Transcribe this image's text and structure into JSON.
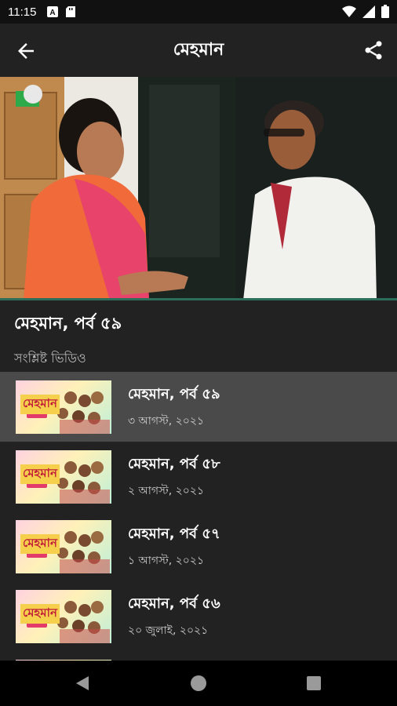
{
  "status_bar": {
    "time": "11:15",
    "icons_left": [
      "a-icon",
      "sd-card-icon"
    ],
    "icons_right": [
      "wifi-icon",
      "signal-icon",
      "battery-icon"
    ]
  },
  "app_bar": {
    "title": "মেহমান",
    "back_icon": "arrow-back-icon",
    "share_icon": "share-icon"
  },
  "video": {
    "title": "মেহমান, পর্ব ৫৯",
    "progress_color": "#2c6e5a"
  },
  "related": {
    "label": "সংশ্লিষ্ট ভিডিও",
    "items": [
      {
        "title": "মেহমান, পর্ব ৫৯",
        "date": "৩ আগস্ট, ২০২১",
        "thumb_text": "মেহমান"
      },
      {
        "title": "মেহমান, পর্ব ৫৮",
        "date": "২ আগস্ট, ২০২১",
        "thumb_text": "মেহমান"
      },
      {
        "title": "মেহমান, পর্ব ৫৭",
        "date": "১ আগস্ট, ২০২১",
        "thumb_text": "মেহমান"
      },
      {
        "title": "মেহমান, পর্ব ৫৬",
        "date": "২০ জুলাই, ২০২১",
        "thumb_text": "মেহমান"
      }
    ]
  },
  "colors": {
    "background": "#222222",
    "active_row": "#4a4a4a",
    "status_bar": "#111111"
  }
}
